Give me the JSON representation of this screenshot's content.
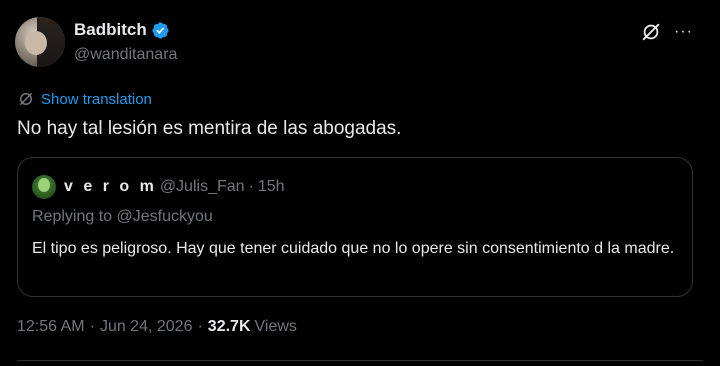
{
  "tweet": {
    "display_name": "Badbitch",
    "handle": "@wanditanara",
    "show_translation": "Show translation",
    "text": "No hay tal lesión es mentira de las abogadas.",
    "more": "···"
  },
  "quote": {
    "name": "v e r o m",
    "handle": "@Julis_Fan",
    "separator": "·",
    "time": "15h",
    "replying_prefix": "Replying to",
    "replying_to": "@Jesfuckyou",
    "text": "El tipo es peligroso. Hay que tener cuidado que no lo opere sin consentimiento d la madre."
  },
  "meta": {
    "time": "12:56 AM",
    "date": "Jun 24, 2026",
    "separator": "·",
    "views_count": "32.7K",
    "views_label": "Views"
  },
  "colors": {
    "background": "#000000",
    "text_primary": "#e7e9ea",
    "text_secondary": "#71767b",
    "accent": "#1d9bf0",
    "border": "#2f3336"
  },
  "icons": [
    "verified-badge-icon",
    "grok-icon",
    "more-icon",
    "translate-icon"
  ]
}
